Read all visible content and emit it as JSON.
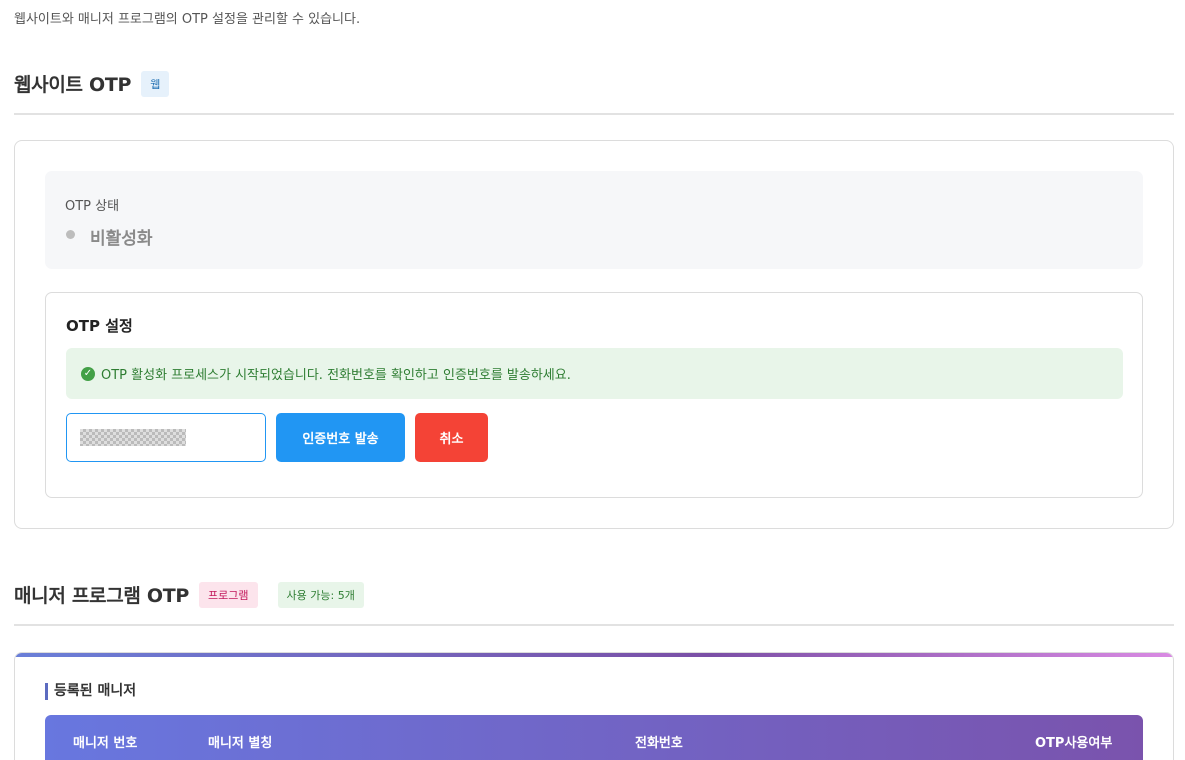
{
  "intro": "웹사이트와 매니저 프로그램의 OTP 설정을 관리할 수 있습니다.",
  "website_otp": {
    "title": "웹사이트 OTP",
    "tag": "웹",
    "status": {
      "label": "OTP 상태",
      "value": "비활성화"
    },
    "setting": {
      "title": "OTP 설정",
      "alert": "OTP 활성화 프로세스가 시작되었습니다. 전화번호를 확인하고 인증번호를 발송하세요.",
      "phone_value": "",
      "send_button": "인증번호 발송",
      "cancel_button": "취소"
    }
  },
  "manager_otp": {
    "title": "매니저 프로그램 OTP",
    "tag": "프로그램",
    "available": "사용 가능: 5개",
    "registered_title": "등록된 매니저",
    "columns": [
      "매니저 번호",
      "매니저 별칭",
      "전화번호",
      "OTP사용여부"
    ]
  },
  "colors": {
    "primary": "#2196f3",
    "danger": "#f44336",
    "success_text": "#2e7d32",
    "success_bg": "#e8f5e9"
  },
  "icons": {
    "alert": "check-circle-icon",
    "status": "status-dot-icon"
  }
}
